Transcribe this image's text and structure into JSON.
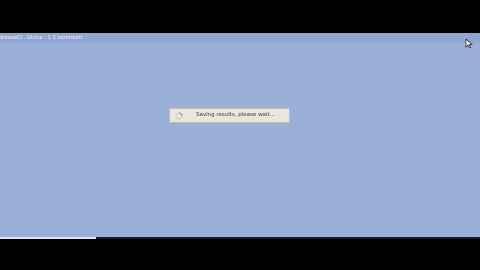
{
  "window": {
    "title": "eleaseCl.. Gtcha : 1 3 nonmeatt"
  },
  "dialog": {
    "message": "Saving results, please wait..."
  },
  "progress": {
    "value": 0.2
  },
  "icons": {
    "cursor": "mouse-pointer-icon",
    "spinner": "loading-spinner-icon"
  }
}
